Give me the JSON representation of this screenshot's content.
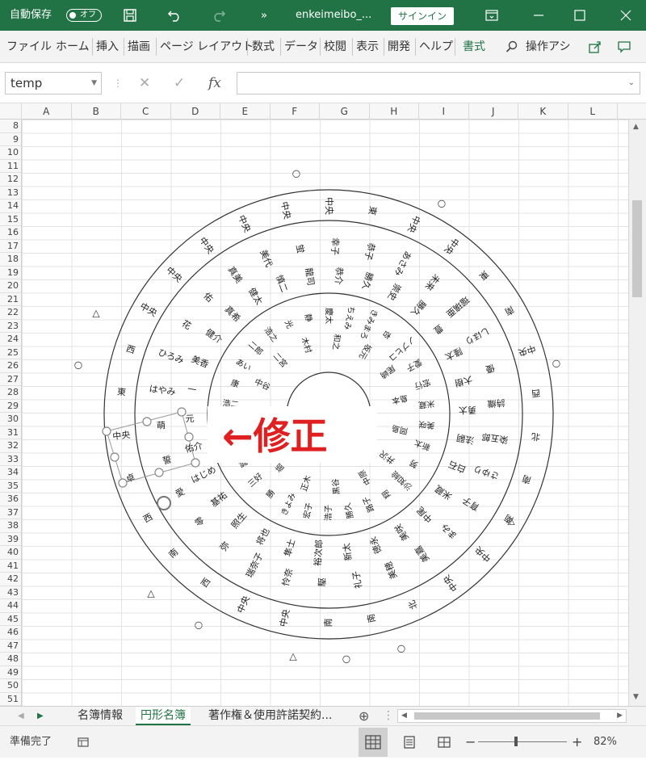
{
  "titlebar": {
    "autosave_label": "自動保存",
    "autosave_state": "オフ",
    "filename": "enkeimeibo_...",
    "signin_label": "サインイン"
  },
  "ribbon": {
    "tabs": [
      "ファイル",
      "ホーム",
      "挿入",
      "描画",
      "ページ レイアウト",
      "数式",
      "データ",
      "校閲",
      "表示",
      "開発",
      "ヘルプ",
      "書式"
    ],
    "search_label": "操作アシ"
  },
  "formula_bar": {
    "name_box": "temp",
    "fx_label": "fx",
    "cancel_glyph": "✕",
    "enter_glyph": "✓",
    "value": ""
  },
  "columns": [
    "A",
    "B",
    "C",
    "D",
    "E",
    "F",
    "G",
    "H",
    "I",
    "J",
    "K",
    "L"
  ],
  "rows": [
    "8",
    "9",
    "10",
    "11",
    "12",
    "13",
    "14",
    "15",
    "16",
    "17",
    "18",
    "19",
    "20",
    "21",
    "22",
    "23",
    "24",
    "25",
    "26",
    "27",
    "28",
    "29",
    "30",
    "31",
    "32",
    "33",
    "34",
    "35",
    "36",
    "37",
    "38",
    "39",
    "40",
    "41",
    "42",
    "43",
    "44",
    "45",
    "46",
    "47",
    "48",
    "49",
    "50",
    "51"
  ],
  "diagram": {
    "annotation": "←修正",
    "annotation_color": "#e02020",
    "outer_ring": [
      "中央",
      "東",
      "中央",
      "中央",
      "東",
      "南",
      "中央",
      "西",
      "北",
      "南",
      "南",
      "中央",
      "中央",
      "北",
      "南",
      "南",
      "中央",
      "中央",
      "西",
      "南",
      "西",
      "卓",
      "中央",
      "東",
      "西",
      "中央",
      "中央",
      "中央",
      "中央",
      "中央"
    ],
    "middle_ring": [
      "幸子",
      "恭子",
      "あさみ",
      "未来",
      "瑠璃亜",
      "しほり",
      "優",
      "詩織",
      "染五郎",
      "さゆり",
      "育子",
      "まみ",
      "美嘉",
      "美穂",
      "礼子",
      "駆",
      "怜奈",
      "瑞奈子",
      "弥",
      "零",
      "愛",
      "誓",
      "萌",
      "はやみ",
      "ひろみ",
      "花",
      "佑",
      "真美",
      "美代",
      "蛍"
    ],
    "inner_ring": [
      "恭介",
      "勝久",
      "崇史",
      "勝久",
      "豊",
      "隆太",
      "大樹",
      "勇太",
      "法嗣",
      "白石",
      "米蔵",
      "中尾",
      "美咲",
      "徳永",
      "新太",
      "裕次郎",
      "隼士",
      "将也",
      "照生",
      "基祐",
      "はじめ",
      "佑介",
      "元",
      "一",
      "美香",
      "健介",
      "真希",
      "健太",
      "慎二",
      "龍司"
    ],
    "core_ring": [
      "慶太",
      "ちえみ",
      "きみまろ",
      "杏",
      "ノブヒコ",
      "愛子",
      "宏行",
      "米蔵",
      "美咲",
      "新太",
      "努",
      "沙知絵",
      "翔",
      "路子",
      "勝久",
      "浩子",
      "宏子",
      "きよみ",
      "勝",
      "三好",
      "誠",
      "隆則",
      "正男",
      "浩二",
      "康",
      "あい",
      "二郎",
      "浩之",
      "光",
      "静"
    ],
    "core_ring2": [
      "和之",
      "坂元",
      "尾崎",
      "島本",
      "岡島",
      "井沢",
      "中原",
      "黒谷",
      "正木",
      "堀",
      "中野",
      "石井",
      "中谷",
      "二宮",
      "木村"
    ],
    "handle_markers": [
      "○",
      "△"
    ]
  },
  "sheet_tabs": [
    "名簿情報",
    "円形名簿",
    "著作権＆使用許諾契約..."
  ],
  "active_sheet": "円形名簿",
  "status": {
    "ready": "準備完了",
    "zoom": "82%",
    "zoom_value": 0.82
  },
  "colors": {
    "brand": "#217346",
    "grid_line": "#e3e3e3"
  }
}
